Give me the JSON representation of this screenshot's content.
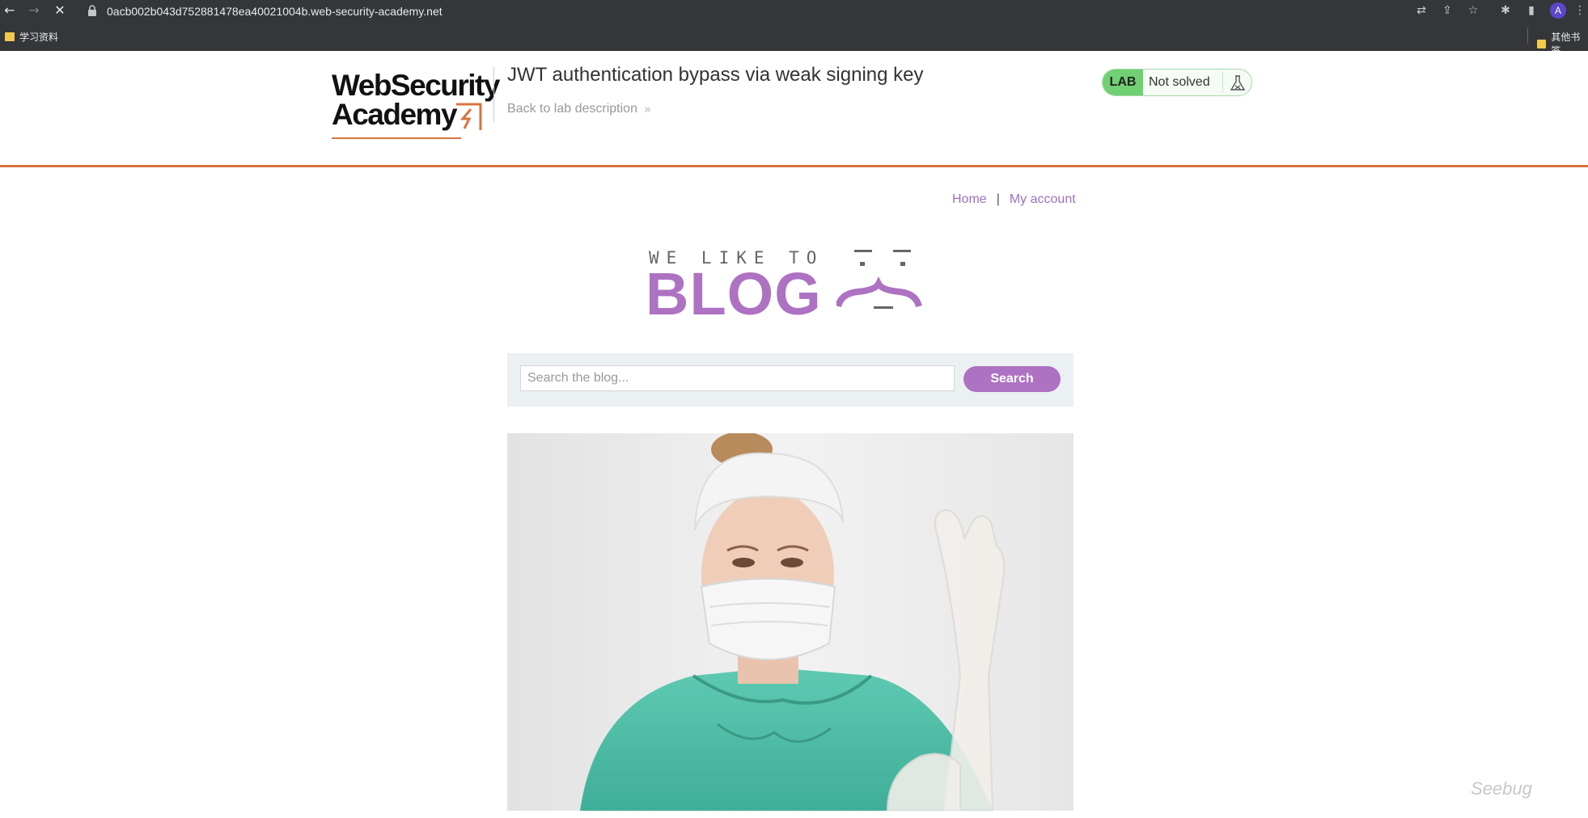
{
  "browser": {
    "url": "0acb002b043d752881478ea40021004b.web-security-academy.net",
    "bookmarks": [
      "学习资料",
      "其他书签"
    ],
    "avatar_letter": "A"
  },
  "lab_header": {
    "logo_line1": "WebSecurity",
    "logo_line2": "Academy",
    "title": "JWT authentication bypass via weak signing key",
    "back_link": "Back to lab description",
    "lab_badge": "LAB",
    "lab_status": "Not solved"
  },
  "nav": {
    "home": "Home",
    "separator": "|",
    "my_account": "My account"
  },
  "blog_logo": {
    "tagline": "WE LIKE TO",
    "word": "BLOG"
  },
  "search": {
    "placeholder": "Search the blog...",
    "button": "Search"
  },
  "watermark": "Seebug",
  "colors": {
    "accent_purple": "#ae72c2",
    "brand_orange": "#d9733f",
    "lab_green": "#70d073",
    "search_panel_bg": "#ebf0f2"
  }
}
